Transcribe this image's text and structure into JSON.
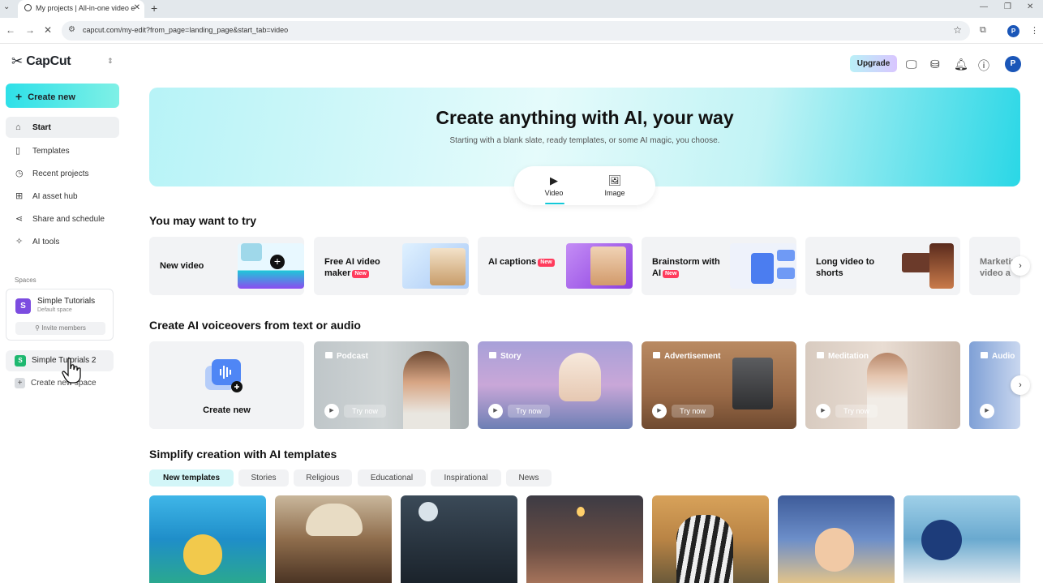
{
  "browser": {
    "tab_title": "My projects | All-in-one video e",
    "url": "capcut.com/my-edit?from_page=landing_page&start_tab=video",
    "profile_initial": "P"
  },
  "app": {
    "name": "CapCut",
    "upgrade_label": "Upgrade",
    "avatar_initial": "P"
  },
  "sidebar": {
    "create_new": "Create new",
    "items": [
      {
        "label": "Start",
        "icon": "home-icon"
      },
      {
        "label": "Templates",
        "icon": "templates-icon"
      },
      {
        "label": "Recent projects",
        "icon": "clock-icon"
      },
      {
        "label": "AI asset hub",
        "icon": "asset-hub-icon"
      },
      {
        "label": "Share and schedule",
        "icon": "share-icon"
      },
      {
        "label": "AI tools",
        "icon": "sparkle-icon"
      }
    ],
    "spaces_label": "Spaces",
    "space1": {
      "initial": "S",
      "name": "Simple Tutorials",
      "sub": "Default space",
      "invite": "Invite members"
    },
    "space2": {
      "initial": "S",
      "name": "Simple Tutorials 2"
    },
    "create_space": "Create new space"
  },
  "hero": {
    "title": "Create anything with AI, your way",
    "subtitle": "Starting with a blank slate, ready templates, or some AI magic, you choose.",
    "modes": [
      {
        "label": "Video",
        "icon": "video-play-icon",
        "active": true
      },
      {
        "label": "Image",
        "icon": "image-icon",
        "active": false
      }
    ]
  },
  "try_section": {
    "title": "You may want to try",
    "cards": [
      {
        "label": "New video",
        "new": false
      },
      {
        "label": "Free AI video maker",
        "new": true
      },
      {
        "label": "AI captions",
        "new": true
      },
      {
        "label": "Brainstorm with AI",
        "new": true
      },
      {
        "label": "Long video to shorts",
        "new": false
      },
      {
        "label": "Marketing video a",
        "new": false
      }
    ],
    "new_badge": "New"
  },
  "voiceover_section": {
    "title": "Create AI voiceovers from text or audio",
    "create_label": "Create new",
    "try_label": "Try now",
    "cards": [
      {
        "label": "Podcast"
      },
      {
        "label": "Story"
      },
      {
        "label": "Advertisement"
      },
      {
        "label": "Meditation"
      },
      {
        "label": "Audio"
      }
    ]
  },
  "templates_section": {
    "title": "Simplify creation with AI templates",
    "chips": [
      "New templates",
      "Stories",
      "Religious",
      "Educational",
      "Inspirational",
      "News"
    ],
    "active_chip": "New templates"
  },
  "colors": {
    "accent": "#13c8d8",
    "new_badge": "#ff3b5c",
    "avatar": "#1a56b8"
  }
}
